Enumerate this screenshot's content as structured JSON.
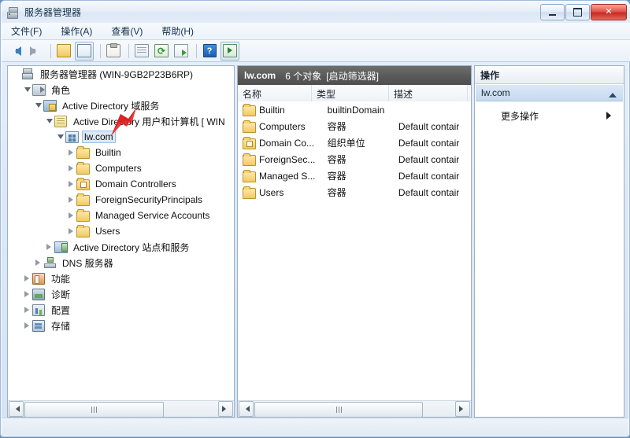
{
  "window": {
    "title": "服务器管理器",
    "icon": "server-manager-icon",
    "buttons": {
      "minimize": "–",
      "maximize": "□",
      "close": "✕"
    }
  },
  "menubar": {
    "items": [
      {
        "label": "文件(F)",
        "name": "menu-file"
      },
      {
        "label": "操作(A)",
        "name": "menu-action"
      },
      {
        "label": "查看(V)",
        "name": "menu-view"
      },
      {
        "label": "帮助(H)",
        "name": "menu-help"
      }
    ]
  },
  "toolbar": {
    "items": [
      {
        "name": "back-arrow-icon",
        "glyph": "←"
      },
      {
        "name": "forward-arrow-icon",
        "glyph": "→"
      },
      {
        "name": "up-folder-icon",
        "glyph": "↑"
      },
      {
        "name": "show-tree-icon",
        "glyph": "▤"
      },
      {
        "name": "properties-icon",
        "glyph": "📋"
      },
      {
        "name": "list-view-icon",
        "glyph": "≣"
      },
      {
        "name": "refresh-icon",
        "glyph": "⟳"
      },
      {
        "name": "export-list-icon",
        "glyph": "▷"
      },
      {
        "name": "help-icon",
        "glyph": "?"
      },
      {
        "name": "show-action-pane-icon",
        "glyph": "▣"
      }
    ]
  },
  "tree": {
    "nodes": [
      {
        "label": "服务器管理器 (WIN-9GB2P23B6RP)",
        "indent": 0,
        "expander": "none",
        "icon": "server-manager-icon",
        "selected": false
      },
      {
        "label": "角色",
        "indent": 1,
        "expander": "down",
        "icon": "roles-icon",
        "selected": false
      },
      {
        "label": "Active Directory 域服务",
        "indent": 2,
        "expander": "down",
        "icon": "ad-ds-icon",
        "selected": false
      },
      {
        "label": "Active Directory 用户和计算机 [ WIN",
        "indent": 3,
        "expander": "down",
        "icon": "aduc-icon",
        "selected": false
      },
      {
        "label": "lw.com",
        "indent": 4,
        "expander": "down",
        "icon": "domain-icon",
        "selected": true
      },
      {
        "label": "Builtin",
        "indent": 5,
        "expander": "right",
        "icon": "folder-icon",
        "selected": false
      },
      {
        "label": "Computers",
        "indent": 5,
        "expander": "right",
        "icon": "folder-icon",
        "selected": false
      },
      {
        "label": "Domain Controllers",
        "indent": 5,
        "expander": "right",
        "icon": "ou-folder-icon",
        "selected": false
      },
      {
        "label": "ForeignSecurityPrincipals",
        "indent": 5,
        "expander": "right",
        "icon": "folder-icon",
        "selected": false
      },
      {
        "label": "Managed Service Accounts",
        "indent": 5,
        "expander": "right",
        "icon": "folder-icon",
        "selected": false
      },
      {
        "label": "Users",
        "indent": 5,
        "expander": "right",
        "icon": "folder-icon",
        "selected": false
      },
      {
        "label": "Active Directory 站点和服务",
        "indent": 3,
        "expander": "right",
        "icon": "ad-sites-icon",
        "selected": false
      },
      {
        "label": "DNS 服务器",
        "indent": 2,
        "expander": "right",
        "icon": "dns-icon",
        "selected": false
      },
      {
        "label": "功能",
        "indent": 1,
        "expander": "right",
        "icon": "features-icon",
        "selected": false
      },
      {
        "label": "诊断",
        "indent": 1,
        "expander": "right",
        "icon": "diagnostics-icon",
        "selected": false
      },
      {
        "label": "配置",
        "indent": 1,
        "expander": "right",
        "icon": "configuration-icon",
        "selected": false
      },
      {
        "label": "存储",
        "indent": 1,
        "expander": "right",
        "icon": "storage-icon",
        "selected": false
      }
    ],
    "hscroll": {
      "left_arrow": "◀",
      "right_arrow": "▶"
    }
  },
  "list": {
    "header": {
      "title": "lw.com",
      "count": "6 个对象",
      "filter": "[启动筛选器]"
    },
    "columns": [
      {
        "label": "名称",
        "name": "column-name"
      },
      {
        "label": "类型",
        "name": "column-type"
      },
      {
        "label": "描述",
        "name": "column-description"
      }
    ],
    "rows": [
      {
        "name": "Builtin",
        "type": "builtinDomain",
        "description": "",
        "icon": "folder-icon"
      },
      {
        "name": "Computers",
        "type": "容器",
        "description": "Default contair",
        "icon": "folder-icon"
      },
      {
        "name": "Domain Co...",
        "type": "组织单位",
        "description": "Default contair",
        "icon": "ou-folder-icon"
      },
      {
        "name": "ForeignSec...",
        "type": "容器",
        "description": "Default contair",
        "icon": "folder-icon"
      },
      {
        "name": "Managed S...",
        "type": "容器",
        "description": "Default contair",
        "icon": "folder-icon"
      },
      {
        "name": "Users",
        "type": "容器",
        "description": "Default contair",
        "icon": "folder-icon"
      }
    ],
    "hscroll": {
      "left_arrow": "◀",
      "right_arrow": "▶"
    }
  },
  "actions": {
    "header": "操作",
    "group": {
      "label": "lw.com",
      "collapse_icon": "chevron-up-icon"
    },
    "items": [
      {
        "label": "更多操作",
        "submenu_icon": "chevron-right-icon"
      }
    ]
  },
  "colors": {
    "selection": "#dbe8f7",
    "list_header_bg": "#5b5b5b",
    "action_group_bg": "#cfe0f3",
    "annotation_arrow": "#e02020",
    "folder": "#f0ca60"
  }
}
